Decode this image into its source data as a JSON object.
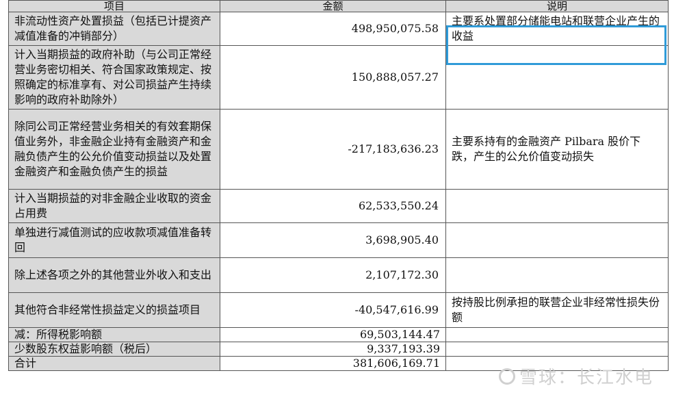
{
  "table": {
    "headers": [
      "项目",
      "金额",
      "说明"
    ],
    "rows": [
      {
        "item": "非流动性资产处置损益（包括已计提资产减值准备的冲销部分）",
        "amount": "498,950,075.58",
        "note": "主要系处置部分储能电站和联营企业产生的收益"
      },
      {
        "item": "计入当期损益的政府补助（与公司正常经营业务密切相关、符合国家政策规定、按照确定的标准享有、对公司损益产生持续影响的政府补助除外）",
        "amount": "150,888,057.27",
        "note": ""
      },
      {
        "item": "除同公司正常经营业务相关的有效套期保值业务外，非金融企业持有金融资产和金融负债产生的公允价值变动损益以及处置金融资产和金融负债产生的损益",
        "amount": "-217,183,636.23",
        "note": "主要系持有的金融资产 Pilbara 股价下跌，产生的公允价值变动损失"
      },
      {
        "item": "计入当期损益的对非金融企业收取的资金占用费",
        "amount": "62,533,550.24",
        "note": ""
      },
      {
        "item": "单独进行减值测试的应收款项减值准备转回",
        "amount": "3,698,905.40",
        "note": ""
      },
      {
        "item": "除上述各项之外的其他营业外收入和支出",
        "amount": "2,107,172.30",
        "note": ""
      },
      {
        "item": "其他符合非经常性损益定义的损益项目",
        "amount": "-40,547,616.99",
        "note": "按持股比例承担的联营企业非经常性损失份额"
      },
      {
        "item": "减：所得税影响额",
        "amount": "69,503,144.47",
        "note": ""
      },
      {
        "item": "少数股东权益影响额（税后）",
        "amount": "9,337,193.39",
        "note": ""
      },
      {
        "item": "合计",
        "amount": "381,606,169.71",
        "note": ""
      }
    ]
  },
  "watermark": {
    "text": "雪球：长江水电"
  },
  "colors": {
    "header_bg": "#d9d9d9",
    "highlight": "#2f9bd8"
  }
}
